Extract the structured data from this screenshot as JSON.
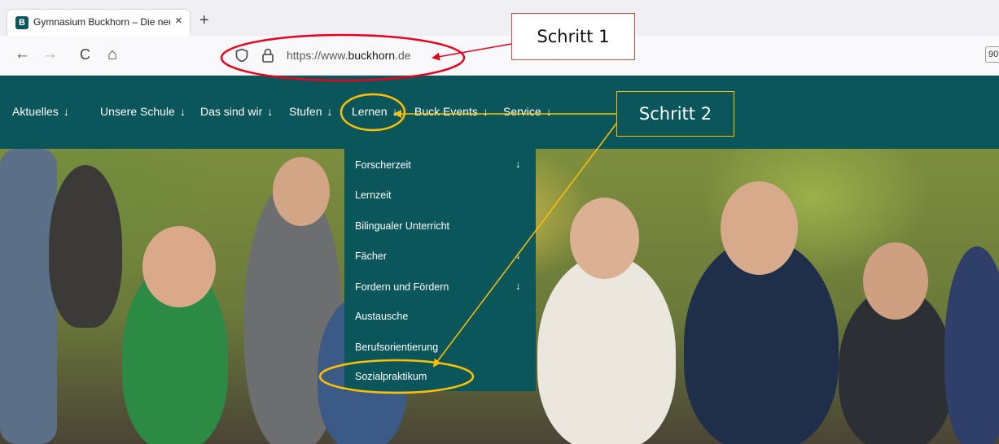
{
  "browser": {
    "tab_title": "Gymnasium Buckhorn – Die neu",
    "tab_favicon": "B",
    "tab_close": "×",
    "new_tab": "+",
    "back": "←",
    "forward": "→",
    "reload": "C",
    "home": "⌂",
    "url_prefix": "https://www.",
    "url_domain": "buckhorn",
    "url_suffix": ".de",
    "zoom": "90"
  },
  "site_nav": {
    "items": [
      {
        "label": "Aktuelles",
        "arrow": "↓"
      },
      {
        "label": "Unsere Schule",
        "arrow": "↓"
      },
      {
        "label": "Das sind wir",
        "arrow": "↓"
      },
      {
        "label": "Stufen",
        "arrow": "↓"
      },
      {
        "label": "Lernen",
        "arrow": "↓"
      },
      {
        "label": "Buck Events",
        "arrow": "↓"
      },
      {
        "label": "Service",
        "arrow": "↓"
      }
    ]
  },
  "dropdown": {
    "items": [
      {
        "label": "Forscherzeit",
        "arrow": "↓"
      },
      {
        "label": "Lernzeit",
        "arrow": ""
      },
      {
        "label": "Bilingualer Unterricht",
        "arrow": ""
      },
      {
        "label": "Fächer",
        "arrow": "↓"
      },
      {
        "label": "Fordern und Fördern",
        "arrow": "↓"
      },
      {
        "label": "Austausche",
        "arrow": ""
      },
      {
        "label": "Berufsorientierung",
        "arrow": ""
      },
      {
        "label": "Sozialpraktikum",
        "arrow": ""
      }
    ]
  },
  "annotations": {
    "step1": "Schritt 1",
    "step2": "Schritt 2",
    "colors": {
      "step1": "#e8001c",
      "step2": "#ffc000"
    }
  }
}
